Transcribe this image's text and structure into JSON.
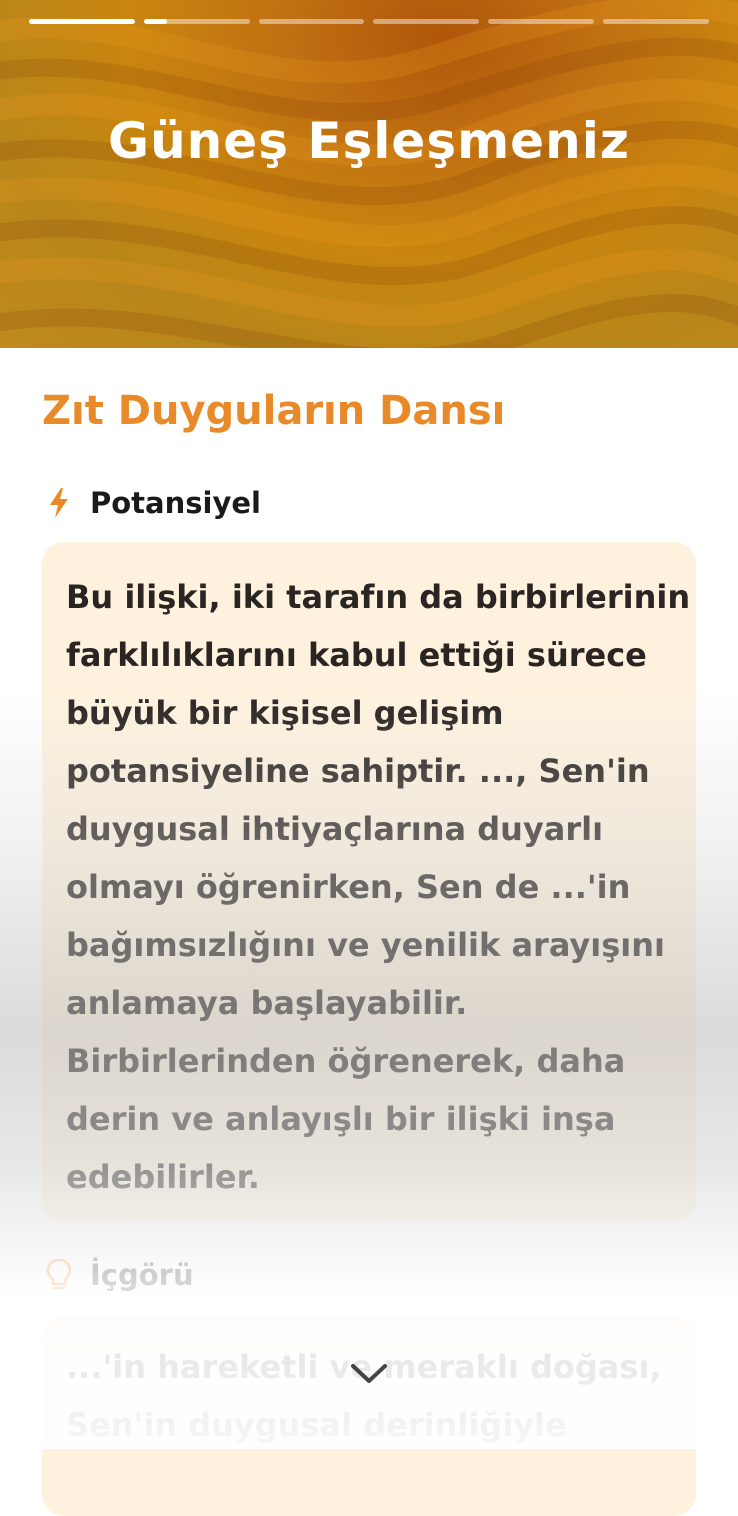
{
  "story_progress": {
    "segments": [
      1,
      0.22,
      0,
      0,
      0,
      0
    ]
  },
  "header": {
    "title": "Güneş Eşleşmeniz"
  },
  "section": {
    "title": "Zıt Duyguların Dansı"
  },
  "potential": {
    "label": "Potansiyel",
    "icon": "lightning-icon",
    "lines": [
      "Bu ilişki, iki tarafın da birbirlerinin",
      "farklılıklarını kabul ettiği sürece",
      "büyük bir kişisel gelişim",
      "potansiyeline sahiptir. ..., Sen'in",
      "duygusal ihtiyaçlarına duyarlı",
      "olmayı öğrenirken, Sen de ...'in",
      "bağımsızlığını ve yenilik arayışını",
      "anlamaya başlayabilir.",
      "Birbirlerinden öğrenerek, daha",
      "derin ve anlayışlı bir ilişki inşa",
      "edebilirler."
    ]
  },
  "insight": {
    "label": "İçgörü",
    "icon": "lightbulb-icon",
    "lines": [
      "...'in hareketli ve meraklı doğası,",
      "Sen'in duygusal derinliğiyle"
    ]
  },
  "scroll_hint": {
    "icon": "chevron-down-icon"
  },
  "colors": {
    "accent": "#e8892a",
    "card_background": "#fef2df",
    "header_gold": "#c9850f"
  }
}
